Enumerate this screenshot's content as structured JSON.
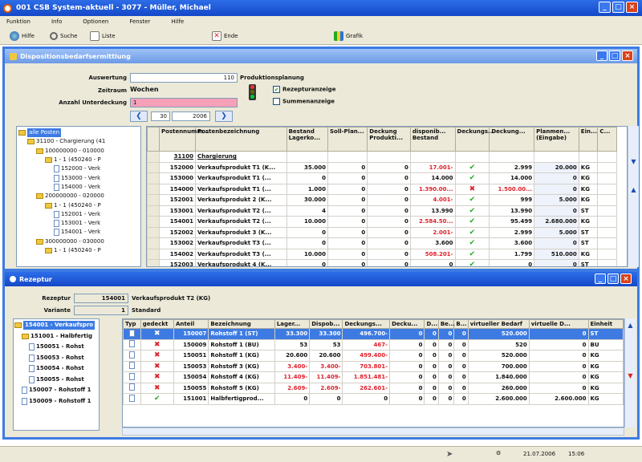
{
  "window": {
    "title": "001  CSB System-aktuell  -  3077  -  Müller, Michael"
  },
  "menu": [
    "Funktion",
    "Info",
    "Optionen",
    "Fenster",
    "Hilfe"
  ],
  "toolbar": {
    "hilfe": "Hilfe",
    "suche": "Suche",
    "liste": "Liste",
    "ende": "Ende",
    "grafik": "Grafik"
  },
  "main": {
    "title": "Dispositionsbedarfsermittlung",
    "auswertung_label": "Auswertung",
    "auswertung_value": "110",
    "auswertung_text": "Produktionsplanung",
    "zeitraum_label": "Zeitraum",
    "zeitraum_value": "Wochen",
    "unterdeckung_label": "Anzahl Unterdeckung",
    "unterdeckung_value": "1",
    "week": "30",
    "year": "2006",
    "opt_rezeptur": "Rezepturanzeige",
    "opt_summen": "Summenanzeige",
    "tree": [
      {
        "label": "alle Posten",
        "indent": 0,
        "icon": "folder"
      },
      {
        "label": "31100 - Chargierung (41",
        "indent": 1,
        "icon": "folder"
      },
      {
        "label": "100000000 - 010000",
        "indent": 2,
        "icon": "folder"
      },
      {
        "label": "1 - 1  (450240 - P",
        "indent": 3,
        "icon": "folder"
      },
      {
        "label": "152000 - Verk",
        "indent": 4,
        "icon": "doc"
      },
      {
        "label": "153000 - Verk",
        "indent": 4,
        "icon": "doc"
      },
      {
        "label": "154000 - Verk",
        "indent": 4,
        "icon": "doc"
      },
      {
        "label": "200000000 - 020000",
        "indent": 2,
        "icon": "folder"
      },
      {
        "label": "1 - 1  (450240 - P",
        "indent": 3,
        "icon": "folder"
      },
      {
        "label": "152001 - Verk",
        "indent": 4,
        "icon": "doc"
      },
      {
        "label": "153001 - Verk",
        "indent": 4,
        "icon": "doc"
      },
      {
        "label": "154001 - Verk",
        "indent": 4,
        "icon": "doc"
      },
      {
        "label": "300000000 - 030000",
        "indent": 2,
        "icon": "folder"
      },
      {
        "label": "1 - 1  (450240 - P",
        "indent": 3,
        "icon": "folder"
      }
    ],
    "columns": [
      "Postennumm...",
      "Postenbezeichnung",
      "Bestand Lagerko...",
      "Soll-Plan...",
      "Deckung Produkti...",
      "disponib... Bestand",
      "Deckungs...",
      "Deckung...",
      "Planmen... (Eingabe)",
      "Ein...",
      "C..."
    ],
    "group": {
      "number": "31100",
      "name": "Chargierung"
    },
    "rows": [
      {
        "nr": "152000",
        "name": "Verkaufsprodukt T1 (K...",
        "bestand": "35.000",
        "soll": "0",
        "deckung": "0",
        "dispo": "17.001-",
        "dispo_red": true,
        "ok": true,
        "deck2": "2.999",
        "deck2_red": false,
        "plan": "20.000",
        "einh": "KG"
      },
      {
        "nr": "153000",
        "name": "Verkaufsprodukt T1 (...",
        "bestand": "0",
        "soll": "0",
        "deckung": "0",
        "dispo": "14.000",
        "dispo_red": false,
        "ok": true,
        "deck2": "14.000",
        "deck2_red": false,
        "plan": "0",
        "einh": "KG"
      },
      {
        "nr": "154000",
        "name": "Verkaufsprodukt T1 (...",
        "bestand": "1.000",
        "soll": "0",
        "deckung": "0",
        "dispo": "1.390.00...",
        "dispo_red": true,
        "ok": false,
        "deck2": "1.500.00...",
        "deck2_red": true,
        "plan": "0",
        "einh": "KG"
      },
      {
        "nr": "152001",
        "name": "Verkaufsprodukt 2 (K...",
        "bestand": "30.000",
        "soll": "0",
        "deckung": "0",
        "dispo": "4.001-",
        "dispo_red": true,
        "ok": true,
        "deck2": "999",
        "deck2_red": false,
        "plan": "5.000",
        "einh": "KG"
      },
      {
        "nr": "153001",
        "name": "Verkaufsprodukt T2 (...",
        "bestand": "4",
        "soll": "0",
        "deckung": "0",
        "dispo": "13.990",
        "dispo_red": false,
        "ok": true,
        "deck2": "13.990",
        "deck2_red": false,
        "plan": "0",
        "einh": "ST"
      },
      {
        "nr": "154001",
        "name": "Verkaufsprodukt T2 (...",
        "bestand": "10.000",
        "soll": "0",
        "deckung": "0",
        "dispo": "2.584.50...",
        "dispo_red": true,
        "ok": true,
        "deck2": "95.499",
        "deck2_red": false,
        "plan": "2.680.000",
        "einh": "KG"
      },
      {
        "nr": "152002",
        "name": "Verkaufsprodukt 3 (K...",
        "bestand": "0",
        "soll": "0",
        "deckung": "0",
        "dispo": "2.001-",
        "dispo_red": true,
        "ok": true,
        "deck2": "2.999",
        "deck2_red": false,
        "plan": "5.000",
        "einh": "ST"
      },
      {
        "nr": "153002",
        "name": "Verkaufsprodukt T3 (...",
        "bestand": "0",
        "soll": "0",
        "deckung": "0",
        "dispo": "3.600",
        "dispo_red": false,
        "ok": true,
        "deck2": "3.600",
        "deck2_red": false,
        "plan": "0",
        "einh": "ST"
      },
      {
        "nr": "154002",
        "name": "Verkaufsprodukt T3 (...",
        "bestand": "10.000",
        "soll": "0",
        "deckung": "0",
        "dispo": "508.201-",
        "dispo_red": true,
        "ok": true,
        "deck2": "1.799",
        "deck2_red": false,
        "plan": "510.000",
        "einh": "KG"
      },
      {
        "nr": "152003",
        "name": "Verkaufsprodukt 4 (K...",
        "bestand": "0",
        "soll": "0",
        "deckung": "0",
        "dispo": "0",
        "dispo_red": false,
        "ok": true,
        "deck2": "0",
        "deck2_red": false,
        "plan": "0",
        "einh": "ST"
      }
    ]
  },
  "rezeptur": {
    "title": "Rezeptur",
    "rez_label": "Rezeptur",
    "rez_value": "154001",
    "rez_text": "Verkaufsprodukt T2 (KG)",
    "var_label": "Variante",
    "var_value": "1",
    "var_text": "Standard",
    "tree": [
      {
        "label": "154001 - Verkaufspro",
        "indent": 0,
        "icon": "folder",
        "sel": true
      },
      {
        "label": "151001 - Halbfertig",
        "indent": 1,
        "icon": "folder",
        "sel": false
      },
      {
        "label": "150051 - Rohst",
        "indent": 2,
        "icon": "doc",
        "sel": false
      },
      {
        "label": "150053 - Rohst",
        "indent": 2,
        "icon": "doc",
        "sel": false
      },
      {
        "label": "150054 - Rohst",
        "indent": 2,
        "icon": "doc",
        "sel": false
      },
      {
        "label": "150055 - Rohst",
        "indent": 2,
        "icon": "doc",
        "sel": false
      },
      {
        "label": "150007 - Rohstoff 1",
        "indent": 1,
        "icon": "doc",
        "sel": false
      },
      {
        "label": "150009 - Rohstoff 1",
        "indent": 1,
        "icon": "doc",
        "sel": false
      }
    ],
    "columns": [
      "Typ",
      "gedeckt",
      "Anteil",
      "Bezeichnung",
      "Lager...",
      "Dispob...",
      "Deckungs...",
      "Decku...",
      "D...",
      "Be...",
      "B...",
      "virtueller Bedarf",
      "virtuelle D...",
      "Einheit"
    ],
    "rows": [
      {
        "ok": false,
        "anteil": "150007",
        "bez": "Rohstoff 1 (ST)",
        "lager": "33.300",
        "dispo": "33.300",
        "deck": "496.700-",
        "d1": "0",
        "d2": "0",
        "b1": "0",
        "b2": "0",
        "vb": "520.000",
        "vd": "0",
        "einh": "ST",
        "sel": true
      },
      {
        "ok": false,
        "anteil": "150009",
        "bez": "Rohstoff 1 (BU)",
        "lager": "53",
        "dispo": "53",
        "deck": "467-",
        "d1": "0",
        "d2": "0",
        "b1": "0",
        "b2": "0",
        "vb": "520",
        "vd": "0",
        "einh": "BU",
        "sel": false
      },
      {
        "ok": false,
        "anteil": "150051",
        "bez": "Rohstoff 1 (KG)",
        "lager": "20.600",
        "dispo": "20.600",
        "deck": "499.400-",
        "d1": "0",
        "d2": "0",
        "b1": "0",
        "b2": "0",
        "vb": "520.000",
        "vd": "0",
        "einh": "KG",
        "sel": false
      },
      {
        "ok": false,
        "anteil": "150053",
        "bez": "Rohstoff 3 (KG)",
        "lager": "3.400-",
        "dispo": "3.400-",
        "deck": "703.801-",
        "d1": "0",
        "d2": "0",
        "b1": "0",
        "b2": "0",
        "vb": "700.000",
        "vd": "0",
        "einh": "KG",
        "sel": false
      },
      {
        "ok": false,
        "anteil": "150054",
        "bez": "Rohstoff 4 (KG)",
        "lager": "11.409-",
        "dispo": "11.409-",
        "deck": "1.851.481-",
        "d1": "0",
        "d2": "0",
        "b1": "0",
        "b2": "0",
        "vb": "1.840.000",
        "vd": "0",
        "einh": "KG",
        "sel": false
      },
      {
        "ok": false,
        "anteil": "150055",
        "bez": "Rohstoff 5 (KG)",
        "lager": "2.609-",
        "dispo": "2.609-",
        "deck": "262.601-",
        "d1": "0",
        "d2": "0",
        "b1": "0",
        "b2": "0",
        "vb": "260.000",
        "vd": "0",
        "einh": "KG",
        "sel": false
      },
      {
        "ok": true,
        "anteil": "151001",
        "bez": "Halbfertigprod...",
        "lager": "0",
        "dispo": "0",
        "deck": "0",
        "d1": "0",
        "d2": "0",
        "b1": "0",
        "b2": "0",
        "vb": "2.600.000",
        "vd": "2.600.000",
        "einh": "KG",
        "sel": false
      }
    ]
  },
  "status": {
    "date": "21.07.2006",
    "time": "15:06"
  }
}
